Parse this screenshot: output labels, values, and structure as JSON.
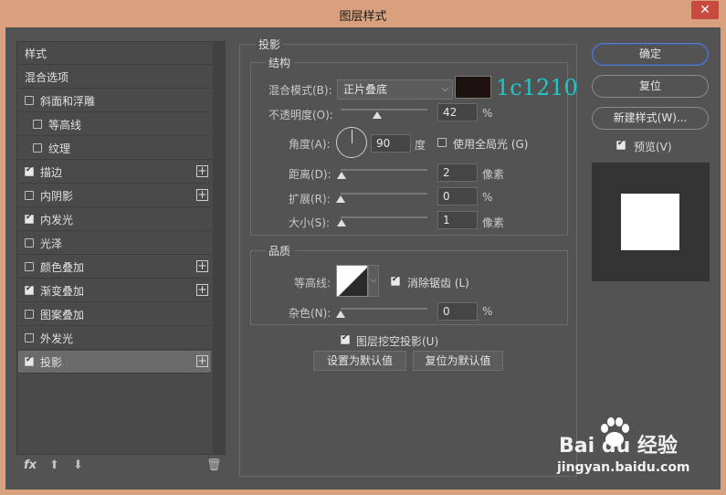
{
  "window": {
    "title": "图层样式",
    "close": "✕"
  },
  "styles_list": {
    "header": "样式",
    "items": [
      {
        "label": "混合选项",
        "checkbox": false,
        "checked": false,
        "plus": false,
        "indent": 0
      },
      {
        "label": "斜面和浮雕",
        "checkbox": true,
        "checked": false,
        "plus": false,
        "indent": 0
      },
      {
        "label": "等高线",
        "checkbox": true,
        "checked": false,
        "plus": false,
        "indent": 1
      },
      {
        "label": "纹理",
        "checkbox": true,
        "checked": false,
        "plus": false,
        "indent": 1
      },
      {
        "label": "描边",
        "checkbox": true,
        "checked": true,
        "plus": true,
        "indent": 0
      },
      {
        "label": "内阴影",
        "checkbox": true,
        "checked": false,
        "plus": true,
        "indent": 0
      },
      {
        "label": "内发光",
        "checkbox": true,
        "checked": true,
        "plus": false,
        "indent": 0
      },
      {
        "label": "光泽",
        "checkbox": true,
        "checked": false,
        "plus": false,
        "indent": 0
      },
      {
        "label": "颜色叠加",
        "checkbox": true,
        "checked": false,
        "plus": true,
        "indent": 0
      },
      {
        "label": "渐变叠加",
        "checkbox": true,
        "checked": true,
        "plus": true,
        "indent": 0
      },
      {
        "label": "图案叠加",
        "checkbox": true,
        "checked": false,
        "plus": false,
        "indent": 0
      },
      {
        "label": "外发光",
        "checkbox": true,
        "checked": false,
        "plus": false,
        "indent": 0
      },
      {
        "label": "投影",
        "checkbox": true,
        "checked": true,
        "plus": true,
        "indent": 0,
        "active": true
      }
    ],
    "bottom": {
      "fx": "fx",
      "up": "⬆",
      "down": "⬇",
      "trash": "🗑"
    }
  },
  "drop_shadow": {
    "section_title": "投影",
    "structure": {
      "title": "结构",
      "blend_mode_label": "混合模式(B):",
      "blend_mode_value": "正片叠底",
      "swatch_color": "#1c1210",
      "swatch_annotation": "1c1210",
      "opacity_label": "不透明度(O):",
      "opacity_value": "42",
      "opacity_unit": "%",
      "opacity_fraction": 0.42,
      "angle_label": "角度(A):",
      "angle_value": "90",
      "angle_unit": "度",
      "global_light_label": "使用全局光 (G)",
      "global_light_checked": false,
      "distance_label": "距离(D):",
      "distance_value": "2",
      "distance_unit": "像素",
      "spread_label": "扩展(R):",
      "spread_value": "0",
      "spread_unit": "%",
      "size_label": "大小(S):",
      "size_value": "1",
      "size_unit": "像素"
    },
    "quality": {
      "title": "品质",
      "contour_label": "等高线:",
      "antialias_label": "消除锯齿 (L)",
      "antialias_checked": true,
      "noise_label": "杂色(N):",
      "noise_value": "0",
      "noise_unit": "%"
    },
    "knockout_label": "图层挖空投影(U)",
    "knockout_checked": true,
    "make_default": "设置为默认值",
    "reset_default": "复位为默认值"
  },
  "actions": {
    "ok": "确定",
    "reset": "复位",
    "new_style": "新建样式(W)...",
    "preview_label": "预览(V)",
    "preview_checked": true
  },
  "watermark": {
    "brand": "Bai du 经验",
    "url": "jingyan.baidu.com"
  },
  "colors": {
    "dialog_bg": "#535353",
    "title_bg": "#d9a07e",
    "annotation": "#1fc7c7"
  }
}
